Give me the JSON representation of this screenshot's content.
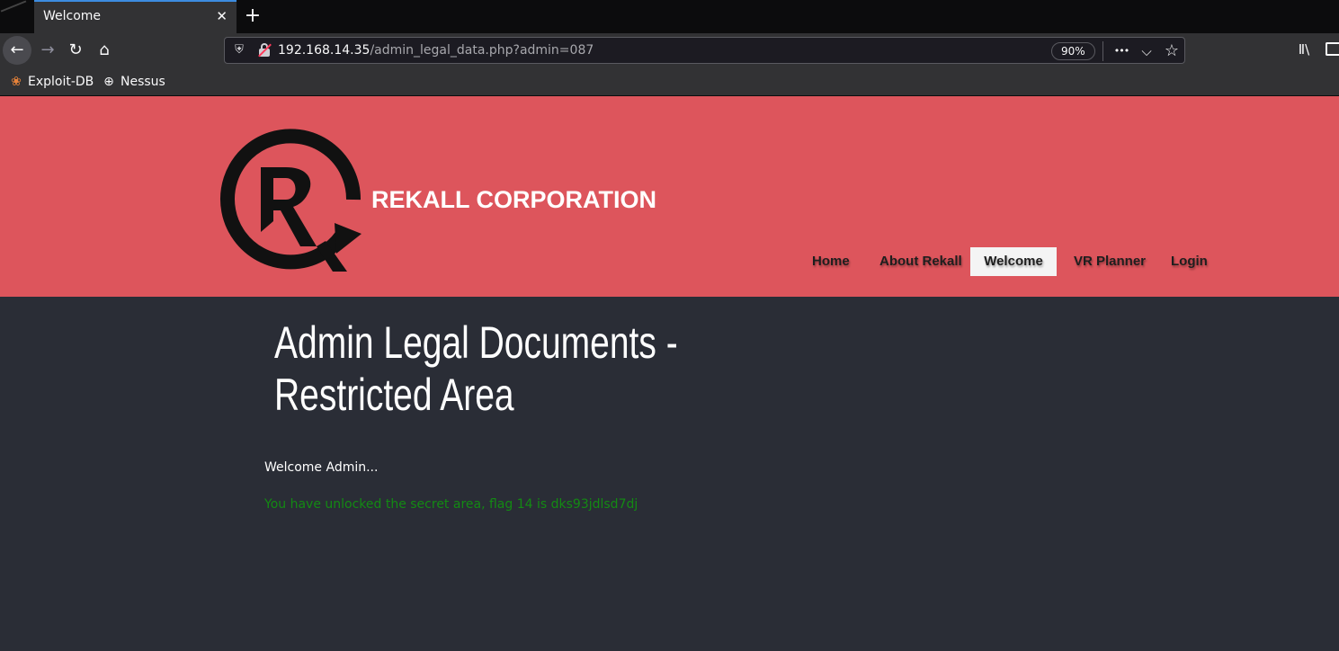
{
  "browser": {
    "tab_title": "Welcome",
    "tab_close_icon": "✕",
    "new_tab_icon": "+",
    "url_host": "192.168.14.35",
    "url_rest": "/admin_legal_data.php?admin=087",
    "zoom": "90%",
    "icons": {
      "back": "←",
      "forward": "→",
      "reload": "↻",
      "home": "⌂",
      "shield": "⛨",
      "more": "•••",
      "pocket": "⌵",
      "star": "☆",
      "library": "Ⅱ\\"
    },
    "bookmarks": [
      {
        "label": "Exploit-DB",
        "icon": "exploit-db-icon",
        "glyph": "❀"
      },
      {
        "label": "Nessus",
        "icon": "globe-icon",
        "glyph": "⊕"
      }
    ]
  },
  "site": {
    "brand": "REKALL CORPORATION",
    "header_color": "#dd555c",
    "nav": [
      {
        "label": "Home"
      },
      {
        "label": "About Rekall"
      },
      {
        "label": "Welcome",
        "active": true
      },
      {
        "label": "VR Planner"
      },
      {
        "label": "Login"
      }
    ],
    "headline_line1": "Admin Legal Documents -",
    "headline_line2": "Restricted Area",
    "welcome_text": "Welcome Admin...",
    "flag_text": "You have unlocked the secret area, flag 14 is dks93jdlsd7dj",
    "flag_color": "#138a13"
  }
}
